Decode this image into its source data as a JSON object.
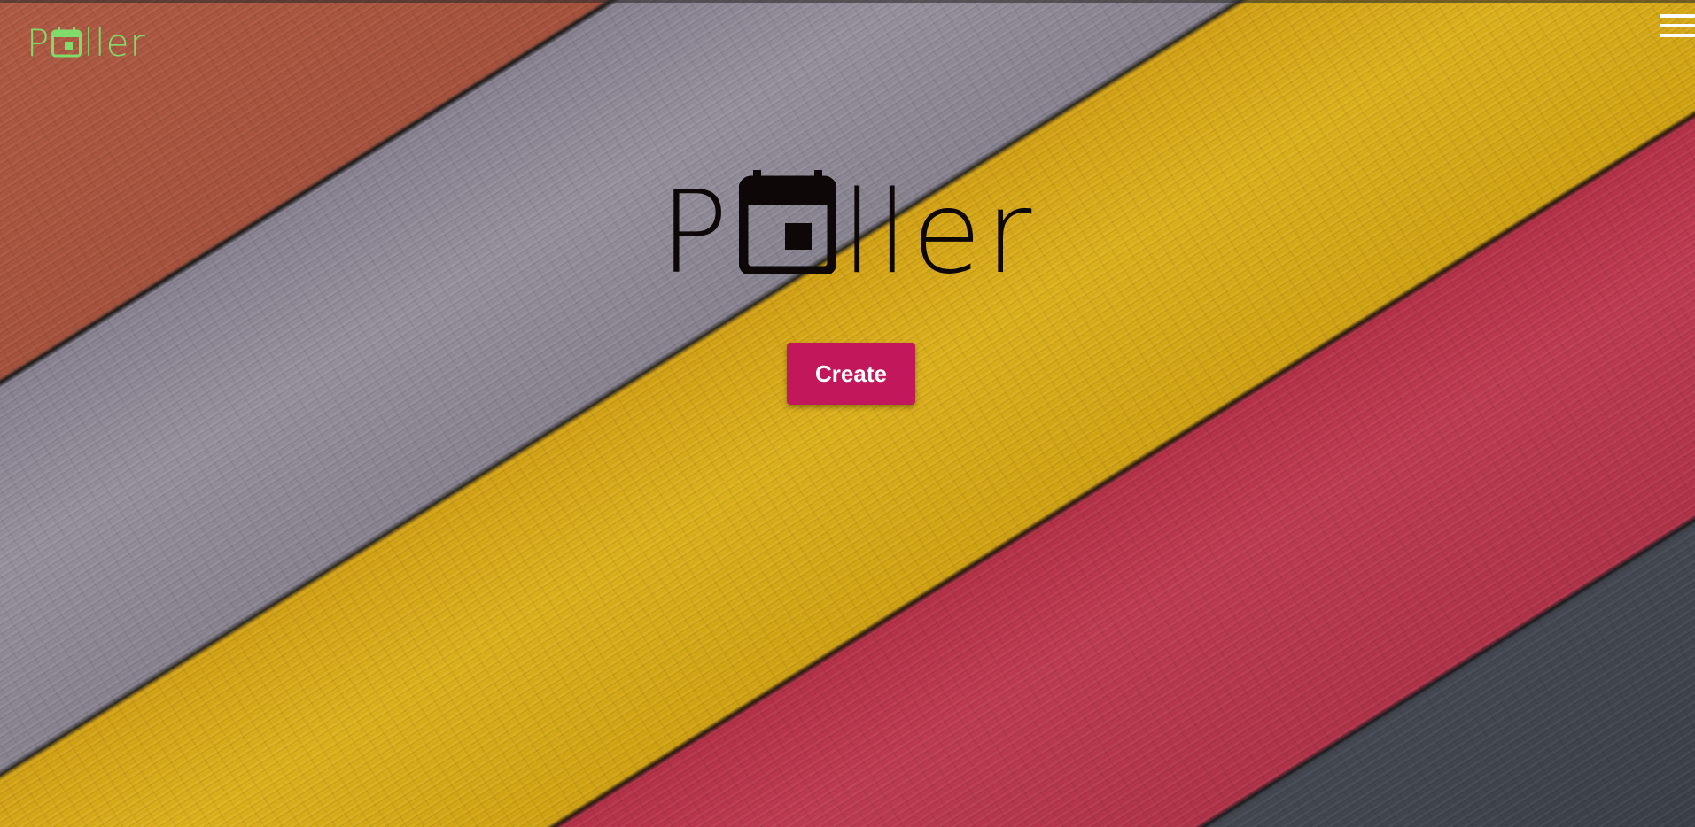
{
  "brand": {
    "prefix": "P",
    "suffix": "ller",
    "icon": "calendar-icon",
    "color": "#7fdc6a"
  },
  "hero": {
    "prefix": "P",
    "suffix": "ller",
    "icon": "calendar-icon",
    "color": "#0d0708"
  },
  "menu": {
    "icon": "hamburger-menu-icon"
  },
  "actions": {
    "create_label": "Create",
    "create_color": "#c2185b"
  }
}
